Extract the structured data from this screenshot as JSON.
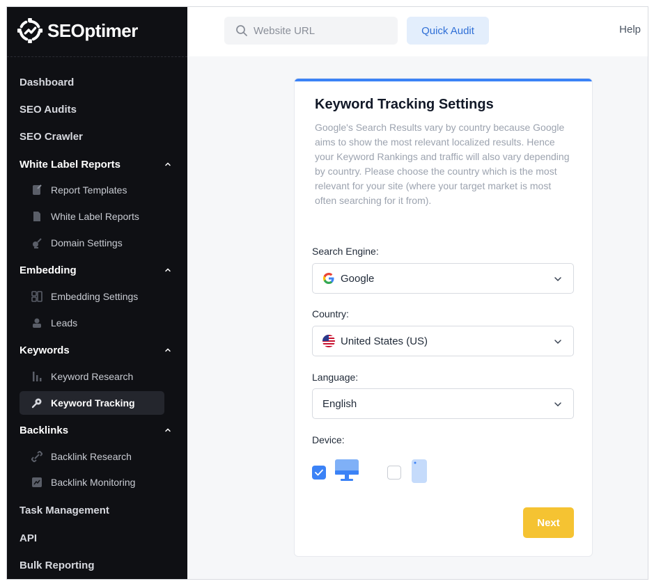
{
  "brand": {
    "name": "SEOptimer"
  },
  "sidebar": {
    "top_items": [
      {
        "label": "Dashboard"
      },
      {
        "label": "SEO Audits"
      },
      {
        "label": "SEO Crawler"
      }
    ],
    "sections": {
      "white_label": {
        "label": "White Label Reports",
        "items": [
          {
            "label": "Report Templates"
          },
          {
            "label": "White Label Reports"
          },
          {
            "label": "Domain Settings"
          }
        ]
      },
      "embedding": {
        "label": "Embedding",
        "items": [
          {
            "label": "Embedding Settings"
          },
          {
            "label": "Leads"
          }
        ]
      },
      "keywords": {
        "label": "Keywords",
        "items": [
          {
            "label": "Keyword Research"
          },
          {
            "label": "Keyword Tracking"
          }
        ]
      },
      "backlinks": {
        "label": "Backlinks",
        "items": [
          {
            "label": "Backlink Research"
          },
          {
            "label": "Backlink Monitoring"
          }
        ]
      }
    },
    "bottom_items": [
      {
        "label": "Task Management"
      },
      {
        "label": "API"
      },
      {
        "label": "Bulk Reporting"
      }
    ],
    "active_item": "Keyword Tracking"
  },
  "topbar": {
    "search_placeholder": "Website URL",
    "quick_audit_label": "Quick Audit",
    "help_label": "Help"
  },
  "card": {
    "title": "Keyword Tracking Settings",
    "description": "Google's Search Results vary by country because Google aims to show the most relevant localized results. Hence your Keyword Rankings and traffic will also vary depending by country. Please choose the country which is the most relevant for your site (where your target market is most often searching for it from).",
    "search_engine": {
      "label": "Search Engine:",
      "value": "Google"
    },
    "country": {
      "label": "Country:",
      "value": "United States (US)"
    },
    "language": {
      "label": "Language:",
      "value": "English"
    },
    "device": {
      "label": "Device:",
      "desktop_checked": true,
      "mobile_checked": false
    },
    "next_label": "Next"
  },
  "colors": {
    "sidebar_bg": "#0f1014",
    "accent_blue": "#3b82f6",
    "next_yellow": "#f5c332",
    "quick_audit_bg": "#e3eefc"
  }
}
